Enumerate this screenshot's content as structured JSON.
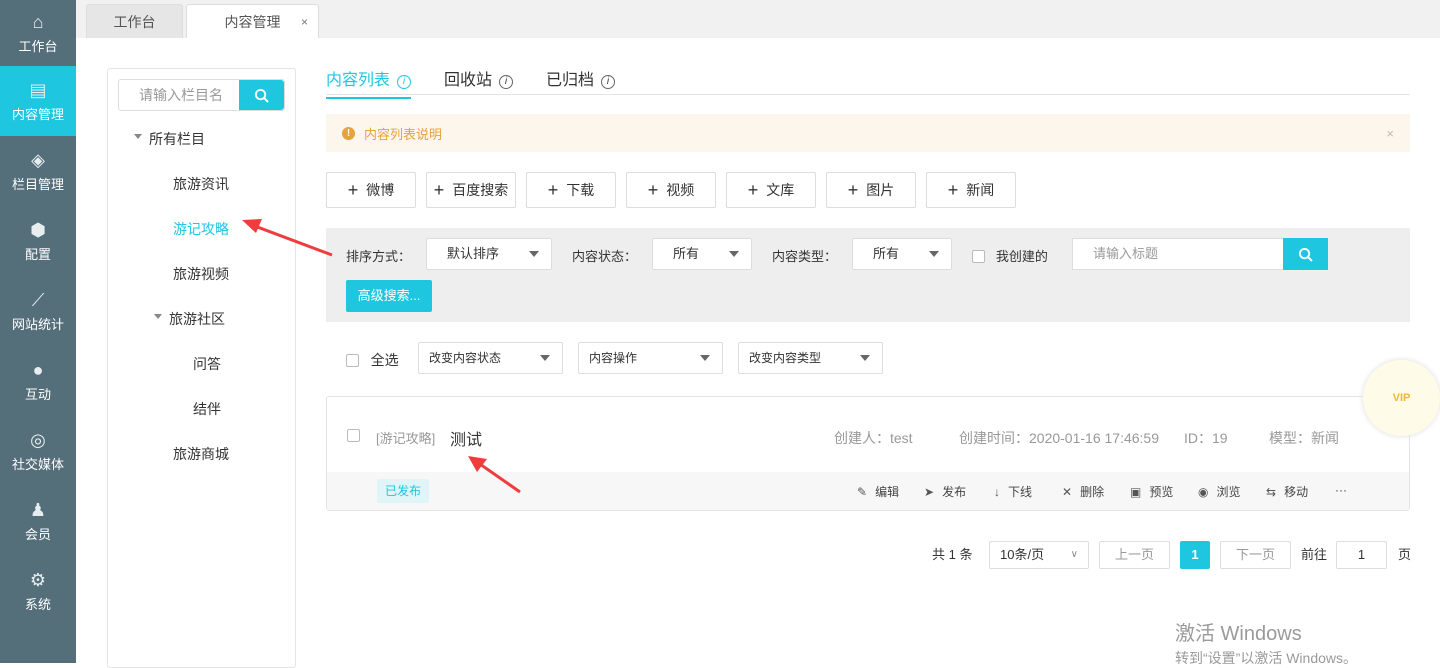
{
  "sidebar": {
    "items": [
      {
        "label": "工作台",
        "icon": "home-icon",
        "glyph": "⌂"
      },
      {
        "label": "内容管理",
        "icon": "document-icon",
        "glyph": "▤"
      },
      {
        "label": "栏目管理",
        "icon": "layers-icon",
        "glyph": "◈"
      },
      {
        "label": "配置",
        "icon": "cube-icon",
        "glyph": "⬢"
      },
      {
        "label": "网站统计",
        "icon": "chart-icon",
        "glyph": "⟋"
      },
      {
        "label": "互动",
        "icon": "chat-icon",
        "glyph": "●"
      },
      {
        "label": "社交媒体",
        "icon": "target-icon",
        "glyph": "◎"
      },
      {
        "label": "会员",
        "icon": "user-icon",
        "glyph": "♟"
      },
      {
        "label": "系统",
        "icon": "gear-icon",
        "glyph": "⚙"
      }
    ]
  },
  "tabs": [
    {
      "label": "工作台"
    },
    {
      "label": "内容管理",
      "close": "×"
    }
  ],
  "tree": {
    "search_placeholder": "请输入栏目名",
    "root": "所有栏目",
    "nodes": [
      "旅游资讯",
      "游记攻略",
      "旅游视频",
      "旅游社区",
      "问答",
      "结伴",
      "旅游商城"
    ]
  },
  "content_tabs": [
    {
      "label": "内容列表"
    },
    {
      "label": "回收站"
    },
    {
      "label": "已归档"
    }
  ],
  "alert": {
    "text": "内容列表说明",
    "close": "×"
  },
  "add_buttons": [
    "微博",
    "百度搜索",
    "下载",
    "视频",
    "文库",
    "图片",
    "新闻"
  ],
  "filter": {
    "sort_label": "排序方式：",
    "sort_value": "默认排序",
    "status_label": "内容状态：",
    "status_value": "所有",
    "type_label": "内容类型：",
    "type_value": "所有",
    "mine_label": "我创建的",
    "title_placeholder": "请输入标题",
    "advanced": "高级搜索..."
  },
  "bulk": {
    "select_all": "全选",
    "change_status": "改变内容状态",
    "operation": "内容操作",
    "change_type": "改变内容类型"
  },
  "item": {
    "category": "[游记攻略]",
    "title": "测试",
    "creator": "创建人：test",
    "created": "创建时间：2020-01-16 17:46:59",
    "id": "ID：19",
    "model": "模型：新闻",
    "status": "已发布",
    "actions": [
      {
        "label": "编辑",
        "glyph": "✎",
        "icon": "edit-icon"
      },
      {
        "label": "发布",
        "glyph": "➤",
        "icon": "send-icon"
      },
      {
        "label": "下线",
        "glyph": "↓",
        "icon": "arrow-down-icon"
      },
      {
        "label": "删除",
        "glyph": "✕",
        "icon": "delete-icon"
      },
      {
        "label": "预览",
        "glyph": "▣",
        "icon": "preview-icon"
      },
      {
        "label": "浏览",
        "glyph": "◉",
        "icon": "eye-icon"
      },
      {
        "label": "移动",
        "glyph": "⇆",
        "icon": "move-icon"
      }
    ],
    "more": "···"
  },
  "pagination": {
    "total": "共 1 条",
    "page_size": "10条/页",
    "prev": "上一页",
    "current": "1",
    "next": "下一页",
    "goto": "前往",
    "goto_value": "1",
    "page_suffix": "页"
  },
  "vip": "VIP",
  "watermark": {
    "line1": "激活 Windows",
    "line2": "转到“设置”以激活 Windows。"
  }
}
